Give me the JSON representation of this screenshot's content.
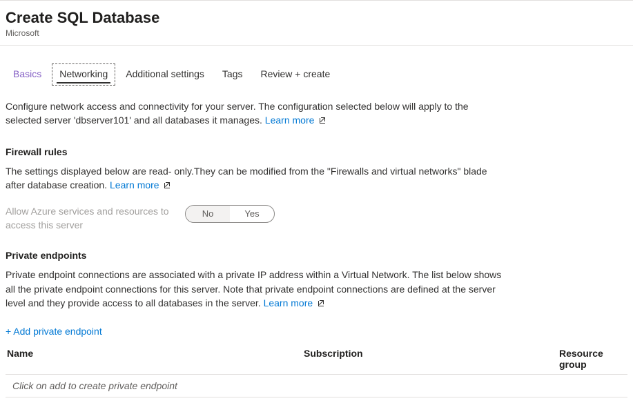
{
  "header": {
    "title": "Create SQL Database",
    "subtitle": "Microsoft"
  },
  "tabs": [
    {
      "label": "Basics"
    },
    {
      "label": "Networking"
    },
    {
      "label": "Additional settings"
    },
    {
      "label": "Tags"
    },
    {
      "label": "Review + create"
    }
  ],
  "intro": {
    "text": "Configure network access and connectivity for your server. The configuration selected below will apply to the selected server 'dbserver101' and all databases it manages. ",
    "learn_more": "Learn more"
  },
  "firewall": {
    "heading": "Firewall rules",
    "text": "The settings displayed below are read- only.They can be modified from the \"Firewalls and virtual networks\" blade after database creation. ",
    "learn_more": "Learn more",
    "allow_label": "Allow Azure services and resources to access this server",
    "toggle": {
      "no": "No",
      "yes": "Yes",
      "selected": "No"
    }
  },
  "private_endpoints": {
    "heading": "Private endpoints",
    "text": "Private endpoint connections are associated with a private IP address within a Virtual Network. The list below shows all the private endpoint connections for this server. Note that private endpoint connections are defined at the server level and they provide access to all databases in the server. ",
    "learn_more": "Learn more",
    "add_label": "+ Add private endpoint",
    "columns": {
      "name": "Name",
      "subscription": "Subscription",
      "resource_group": "Resource group"
    },
    "placeholder": "Click on add to create private endpoint"
  }
}
